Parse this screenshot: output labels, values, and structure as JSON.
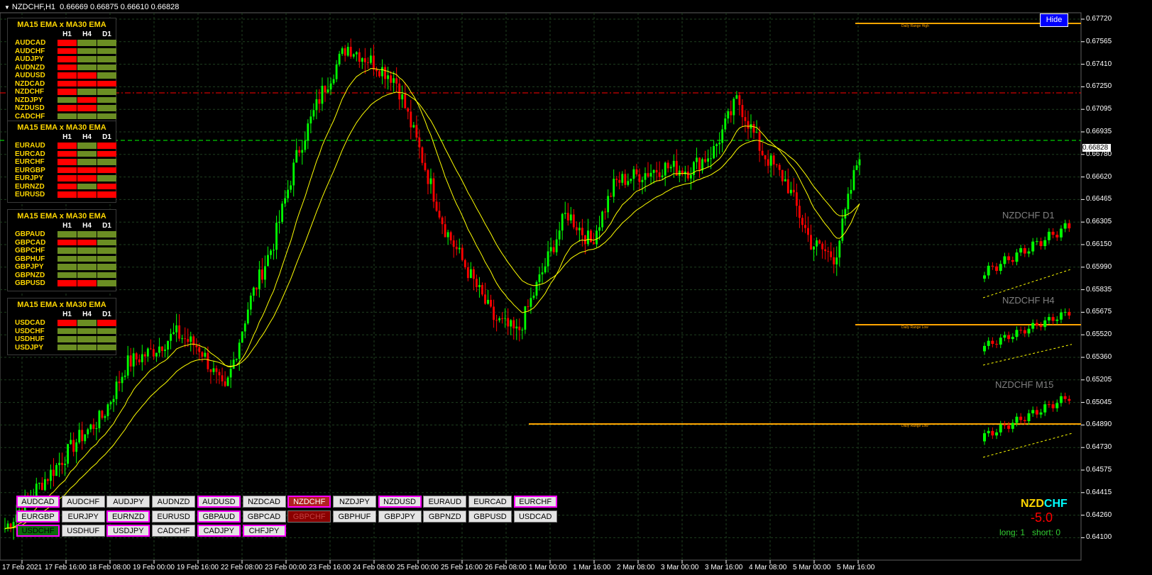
{
  "title": {
    "symbol": "NZDCHF,H1",
    "prices": "0.66669 0.66875 0.66610 0.66828"
  },
  "hide_label": "Hide",
  "colors": {
    "bull": "#00ff00",
    "bear": "#ff0000",
    "ma_fast": "#ffff00",
    "ma_slow": "#ffff00",
    "range": "#ffa500",
    "grid": "#1f3f1f",
    "red_line": "#ff0000",
    "green_line": "#00ff00"
  },
  "panels": [
    {
      "header": "MA15 EMA  x  MA30 EMA",
      "cols": [
        "H1",
        "H4",
        "D1"
      ],
      "rows": [
        {
          "sym": "AUDCAD",
          "c": [
            "red",
            "olive",
            "olive"
          ]
        },
        {
          "sym": "AUDCHF",
          "c": [
            "red",
            "olive",
            "olive"
          ]
        },
        {
          "sym": "AUDJPY",
          "c": [
            "red",
            "olive",
            "olive"
          ]
        },
        {
          "sym": "AUDNZD",
          "c": [
            "red",
            "olive",
            "olive"
          ]
        },
        {
          "sym": "AUDUSD",
          "c": [
            "red",
            "red",
            "olive"
          ]
        },
        {
          "sym": "NZDCAD",
          "c": [
            "red",
            "red",
            "red"
          ]
        },
        {
          "sym": "NZDCHF",
          "c": [
            "red",
            "olive",
            "olive"
          ]
        },
        {
          "sym": "NZDJPY",
          "c": [
            "olive",
            "red",
            "olive"
          ]
        },
        {
          "sym": "NZDUSD",
          "c": [
            "red",
            "red",
            "olive"
          ]
        },
        {
          "sym": "CADCHF",
          "c": [
            "olive",
            "olive",
            "olive"
          ]
        }
      ]
    },
    {
      "header": "MA15 EMA  x  MA30 EMA",
      "cols": [
        "H1",
        "H4",
        "D1"
      ],
      "rows": [
        {
          "sym": "EURAUD",
          "c": [
            "red",
            "olive",
            "red"
          ]
        },
        {
          "sym": "EURCAD",
          "c": [
            "red",
            "olive",
            "red"
          ]
        },
        {
          "sym": "EURCHF",
          "c": [
            "red",
            "olive",
            "olive"
          ]
        },
        {
          "sym": "EURGBP",
          "c": [
            "red",
            "red",
            "red"
          ]
        },
        {
          "sym": "EURJPY",
          "c": [
            "red",
            "red",
            "olive"
          ]
        },
        {
          "sym": "EURNZD",
          "c": [
            "red",
            "olive",
            "red"
          ]
        },
        {
          "sym": "EURUSD",
          "c": [
            "red",
            "red",
            "red"
          ]
        }
      ]
    },
    {
      "header": "MA15 EMA  x  MA30 EMA",
      "cols": [
        "H1",
        "H4",
        "D1"
      ],
      "rows": [
        {
          "sym": "GBPAUD",
          "c": [
            "olive",
            "olive",
            "olive"
          ]
        },
        {
          "sym": "GBPCAD",
          "c": [
            "red",
            "red",
            "olive"
          ]
        },
        {
          "sym": "GBPCHF",
          "c": [
            "olive",
            "olive",
            "olive"
          ]
        },
        {
          "sym": "GBPHUF",
          "c": [
            "olive",
            "olive",
            "olive"
          ]
        },
        {
          "sym": "GBPJPY",
          "c": [
            "olive",
            "olive",
            "olive"
          ]
        },
        {
          "sym": "GBPNZD",
          "c": [
            "olive",
            "olive",
            "olive"
          ]
        },
        {
          "sym": "GBPUSD",
          "c": [
            "red",
            "red",
            "olive"
          ]
        }
      ]
    },
    {
      "header": "MA15 EMA  x  MA30 EMA",
      "cols": [
        "H1",
        "H4",
        "D1"
      ],
      "rows": [
        {
          "sym": "USDCAD",
          "c": [
            "red",
            "olive",
            "red"
          ]
        },
        {
          "sym": "USDCHF",
          "c": [
            "olive",
            "olive",
            "olive"
          ]
        },
        {
          "sym": "USDHUF",
          "c": [
            "olive",
            "olive",
            "olive"
          ]
        },
        {
          "sym": "USDJPY",
          "c": [
            "olive",
            "olive",
            "olive"
          ]
        }
      ]
    }
  ],
  "buttons": [
    [
      "AUDCAD",
      "AUDCHF",
      "AUDJPY",
      "AUDNZD",
      "AUDUSD",
      "NZDCAD",
      "NZDCHF",
      "NZDJPY",
      "NZDUSD",
      "EURAUD",
      "EURCAD",
      "EURCHF"
    ],
    [
      "EURGBP",
      "EURJPY",
      "EURNZD",
      "EURUSD",
      "GBPAUD",
      "GBPCAD",
      "GBPCHF",
      "GBPHUF",
      "GBPJPY",
      "GBPNZD",
      "GBPUSD",
      "USDCAD"
    ],
    [
      "USDCHF",
      "USDHUF",
      "USDJPY",
      "CADCHF",
      "CADJPY",
      "CHFJPY"
    ]
  ],
  "y_axis": [
    "0.67720",
    "0.67565",
    "0.67410",
    "0.67250",
    "0.67095",
    "0.66935",
    "0.66780",
    "0.66620",
    "0.66465",
    "0.66305",
    "0.66150",
    "0.65990",
    "0.65835",
    "0.65675",
    "0.65520",
    "0.65360",
    "0.65205",
    "0.65045",
    "0.64890",
    "0.64730",
    "0.64575",
    "0.64415",
    "0.64260",
    "0.64100"
  ],
  "current_price": "0.66828",
  "x_axis": [
    "17 Feb 2021",
    "17 Feb 16:00",
    "18 Feb 08:00",
    "19 Feb 00:00",
    "19 Feb 16:00",
    "22 Feb 08:00",
    "23 Feb 00:00",
    "23 Feb 16:00",
    "24 Feb 08:00",
    "25 Feb 00:00",
    "25 Feb 16:00",
    "26 Feb 08:00",
    "1 Mar 00:00",
    "1 Mar 16:00",
    "2 Mar 08:00",
    "3 Mar 00:00",
    "3 Mar 16:00",
    "4 Mar 08:00",
    "5 Mar 00:00",
    "5 Mar 16:00"
  ],
  "range_labels": {
    "high": "Daily Range High",
    "low": "Daily Range Low"
  },
  "mini_titles": [
    "NZDCHF D1",
    "NZDCHF H4",
    "NZDCHF M15"
  ],
  "signal": {
    "base": "NZD",
    "quote": "CHF",
    "value": "-5.0",
    "long": "long: 1",
    "short": "short: 0"
  },
  "chart_data": {
    "type": "candlestick",
    "symbol": "NZDCHF",
    "timeframe": "H1",
    "ylim": [
      0.641,
      0.6772
    ],
    "series": [
      {
        "name": "price",
        "values": [
          0.6431,
          0.6452,
          0.647,
          0.649,
          0.6505,
          0.654,
          0.6548,
          0.656,
          0.655,
          0.652,
          0.658,
          0.662,
          0.668,
          0.672,
          0.675,
          0.674,
          0.6728,
          0.668,
          0.663,
          0.66,
          0.657,
          0.656,
          0.66,
          0.664,
          0.662,
          0.666,
          0.6665,
          0.667,
          0.6668,
          0.668,
          0.6715,
          0.668,
          0.666,
          0.662,
          0.661,
          0.668
        ]
      }
    ]
  }
}
